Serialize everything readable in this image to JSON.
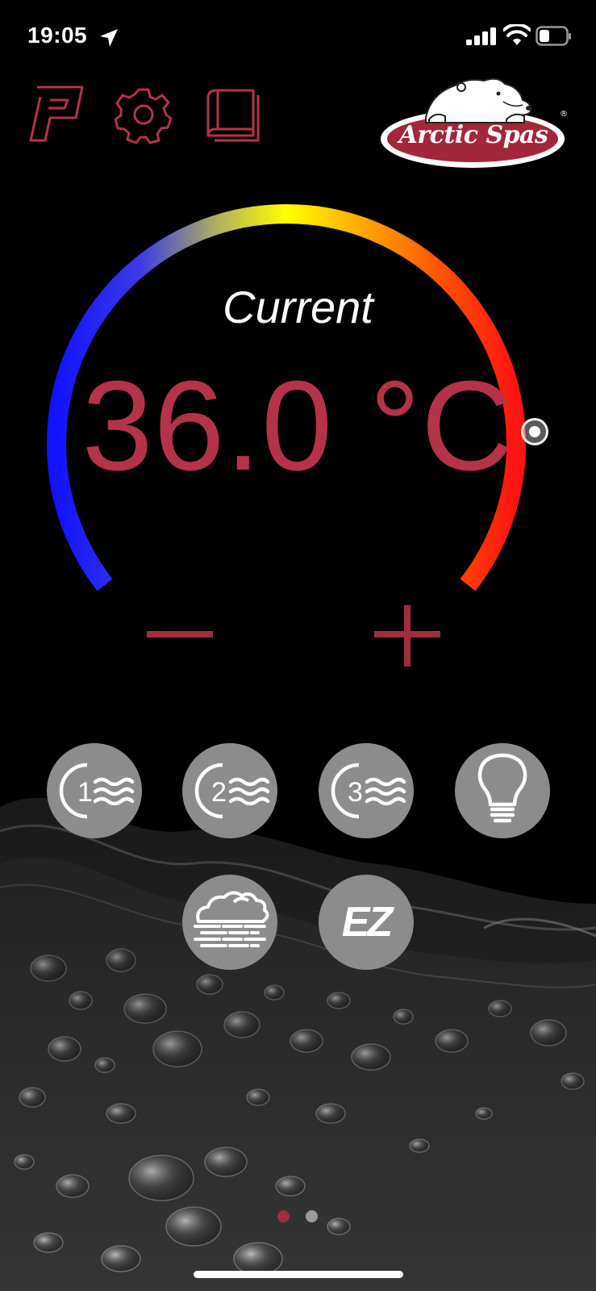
{
  "status_bar": {
    "time": "19:05",
    "icons": [
      "location-arrow-icon",
      "cellular-signal-icon",
      "wifi-icon",
      "battery-icon"
    ]
  },
  "header": {
    "icons": [
      "power-p-icon",
      "gear-icon",
      "manual-book-icon"
    ],
    "logo_text": "Arctic Spas",
    "accent_color": "#b5334a"
  },
  "thermostat": {
    "label": "Current",
    "temperature": "36.0 °C",
    "temperature_color": "#b5334a",
    "gradient_colors": [
      "#1a1aff",
      "#ffff00",
      "#ff1a1a"
    ],
    "minus_label": "−",
    "plus_label": "+"
  },
  "controls": [
    {
      "name": "jet-1",
      "number": "1",
      "icon": "jets-icon"
    },
    {
      "name": "jet-2",
      "number": "2",
      "icon": "jets-icon"
    },
    {
      "name": "jet-3",
      "number": "3",
      "icon": "jets-icon"
    },
    {
      "name": "light",
      "icon": "lightbulb-icon"
    },
    {
      "name": "fog",
      "icon": "fog-cloud-icon"
    },
    {
      "name": "ez",
      "text": "EZ",
      "icon": "ez-icon"
    }
  ],
  "pagination": {
    "total": 2,
    "active": 1
  }
}
